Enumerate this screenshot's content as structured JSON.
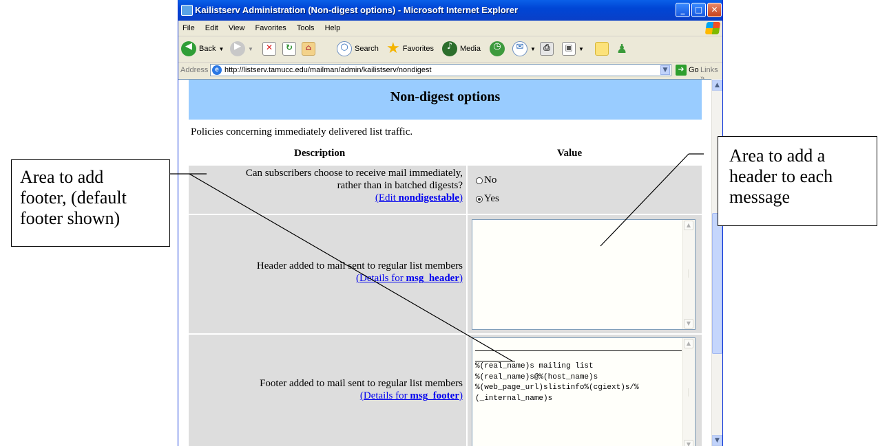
{
  "window": {
    "title": "Kailistserv Administration (Non-digest options) - Microsoft Internet Explorer",
    "min": "_",
    "max": "□",
    "close": "✕"
  },
  "menu": [
    "File",
    "Edit",
    "View",
    "Favorites",
    "Tools",
    "Help"
  ],
  "toolbar": {
    "back": "Back",
    "search": "Search",
    "favorites": "Favorites",
    "media": "Media"
  },
  "address": {
    "label": "Address",
    "url": "http://listserv.tamucc.edu/mailman/admin/kailistserv/nondigest",
    "go": "Go",
    "links": "Links »"
  },
  "page": {
    "heading": "Non-digest options",
    "intro": "Policies concerning immediately delivered list traffic.",
    "col_description": "Description",
    "col_value": "Value",
    "rows": [
      {
        "question_line1": "Can subscribers choose to receive mail immediately,",
        "question_line2": "rather than in batched digests?",
        "link_prefix": "(Edit ",
        "link_bold": "nondigestable",
        "link_suffix": ")",
        "options": [
          {
            "label": "No",
            "selected": false
          },
          {
            "label": "Yes",
            "selected": true
          }
        ]
      },
      {
        "question_line1": "Header added to mail sent to regular list members",
        "link_prefix": "(Details for ",
        "link_bold": "msg_header",
        "link_suffix": ")",
        "value": ""
      },
      {
        "question_line1": "Footer added to mail sent to regular list members",
        "link_prefix": "(Details for ",
        "link_bold": "msg_footer",
        "link_suffix": ")",
        "value_lines": [
          "%(real_name)s mailing list",
          "%(real_name)s@%(host_name)s",
          "%(web_page_url)slistinfo%(cgiext)s/%",
          "(_internal_name)s"
        ]
      }
    ]
  },
  "callouts": {
    "left": [
      "Area to add",
      "footer, (default",
      "footer shown)"
    ],
    "right": [
      "Area to add a",
      "header to each",
      "message"
    ]
  }
}
